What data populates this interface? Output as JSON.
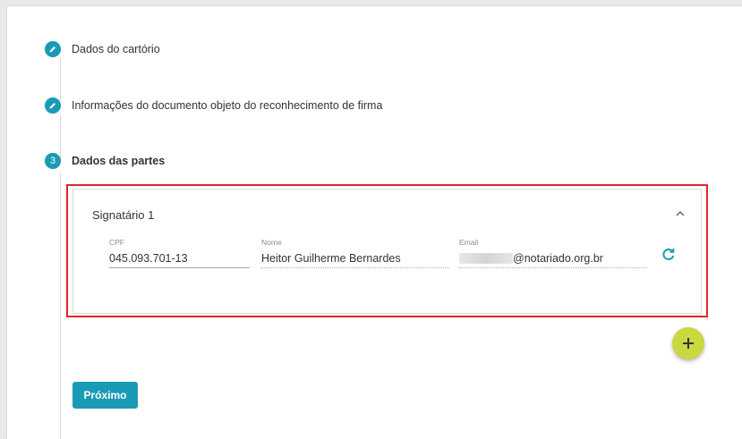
{
  "steps": [
    {
      "label": "Dados do cartório",
      "state": "done",
      "icon": "pencil-icon"
    },
    {
      "label": "Informações do documento objeto do reconhecimento de firma",
      "state": "done",
      "icon": "pencil-icon"
    },
    {
      "label": "Dados das partes",
      "state": "active",
      "number": "3"
    }
  ],
  "signatory": {
    "title": "Signatário 1",
    "fields": {
      "cpf": {
        "label": "CPF",
        "value": "045.093.701-13"
      },
      "name": {
        "label": "Nome",
        "value": "Heitor Guilherme Bernardes"
      },
      "email": {
        "label": "Email",
        "value": "@notariado.org.br"
      }
    }
  },
  "actions": {
    "next_label": "Próximo"
  },
  "colors": {
    "accent": "#1a9bb5",
    "fab": "#c7d841",
    "highlight": "#e3242b"
  }
}
